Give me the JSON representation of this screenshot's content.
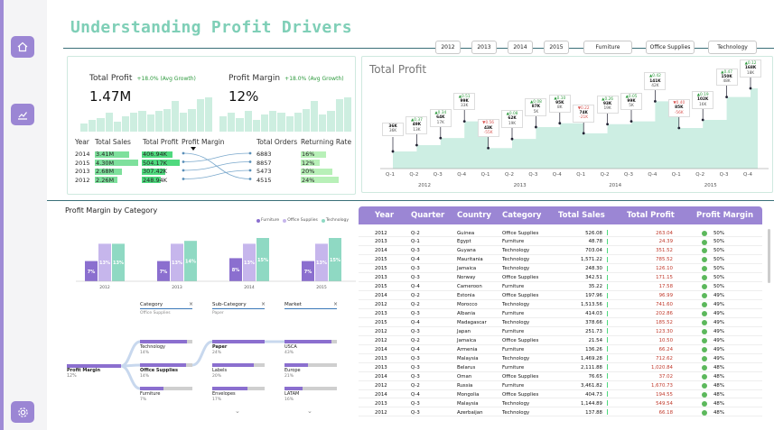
{
  "colors": {
    "accent": "#9b86d4",
    "mint": "#7fcfb7",
    "furniture": "#8b6fcf",
    "office": "#c6b6ec",
    "technology": "#8fd9c3",
    "up": "#2e9a3e",
    "down": "#d9534f"
  },
  "title": "Understanding Profit Drivers",
  "nav": {
    "icons": [
      "home-icon",
      "chart-icon",
      "settings-icon"
    ]
  },
  "slicers": {
    "years": [
      "2012",
      "2013",
      "2014",
      "2015"
    ],
    "categories": [
      "Furniture",
      "Office Supplies",
      "Technology"
    ]
  },
  "kpi": {
    "total_profit": {
      "label": "Total Profit",
      "growth": "+18.0% (Avg Growth)",
      "value": "1.47M"
    },
    "profit_margin": {
      "label": "Profit Margin",
      "growth": "+18.0% (Avg Growth)",
      "value": "12%"
    }
  },
  "year_table": {
    "headers": [
      "Year",
      "Total Sales",
      "Total Profit",
      "Profit Margin",
      "Total Orders",
      "Returning Rate"
    ],
    "rows": [
      {
        "year": "2014",
        "sales": "3.41M",
        "profit": "406.94K",
        "orders": "6883",
        "rate": "16%",
        "s": 0.79,
        "p": 0.81,
        "r": 0.67
      },
      {
        "year": "2015",
        "sales": "4.30M",
        "profit": "504.17K",
        "orders": "8857",
        "rate": "12%",
        "s": 1.0,
        "p": 1.0,
        "r": 0.5
      },
      {
        "year": "2013",
        "sales": "2.68M",
        "profit": "307.42K",
        "orders": "5473",
        "rate": "20%",
        "s": 0.62,
        "p": 0.61,
        "r": 0.83
      },
      {
        "year": "2012",
        "sales": "2.26M",
        "profit": "248.94K",
        "orders": "4515",
        "rate": "24%",
        "s": 0.53,
        "p": 0.49,
        "r": 1.0
      }
    ]
  },
  "total_profit_chart": {
    "title": "Total Profit",
    "years": [
      "2012",
      "2013",
      "2014",
      "2015"
    ],
    "quarters": [
      "Q-1",
      "Q-2",
      "Q-3",
      "Q-4"
    ],
    "points": [
      {
        "v": "36K",
        "s": "36K",
        "c": ""
      },
      {
        "v": "49K",
        "s": "13K",
        "c": "▲0.37"
      },
      {
        "v": "64K",
        "s": "17K",
        "c": "▲0.34"
      },
      {
        "v": "99K",
        "s": "33K",
        "c": "▲0.51"
      },
      {
        "v": "43K",
        "s": "-55K",
        "c": "▼0.56"
      },
      {
        "v": "62K",
        "s": "19K",
        "c": "▲0.08"
      },
      {
        "v": "87K",
        "s": "5K",
        "c": "▲0.08"
      },
      {
        "v": "95K",
        "s": "8K",
        "c": "▲0.10"
      },
      {
        "v": "74K",
        "s": "-21K",
        "c": "▼0.22"
      },
      {
        "v": "93K",
        "s": "19K",
        "c": "▲0.26"
      },
      {
        "v": "99K",
        "s": "5K",
        "c": "▲0.05"
      },
      {
        "v": "141K",
        "s": "42K",
        "c": "▲0.42"
      },
      {
        "v": "85K",
        "s": "-56K",
        "c": "▼0.40"
      },
      {
        "v": "102K",
        "s": "16K",
        "c": "▲0.19"
      },
      {
        "v": "150K",
        "s": "48K",
        "c": "▲0.47"
      },
      {
        "v": "168K",
        "s": "18K",
        "c": "▲0.12"
      }
    ]
  },
  "margin_by_category": {
    "title": "Profit Margin by Category",
    "legend": [
      "Furniture",
      "Office Supplies",
      "Technology"
    ],
    "years": [
      "2012",
      "2013",
      "2014",
      "2015"
    ],
    "values": [
      [
        7,
        13,
        13
      ],
      [
        7,
        13,
        14
      ],
      [
        8,
        13,
        15
      ],
      [
        7,
        13,
        15
      ]
    ]
  },
  "decomp_tree": {
    "root": {
      "label": "Profit Margin",
      "value": "12%"
    },
    "levels": [
      {
        "header": "Category",
        "sub": "Office Supplies",
        "items": [
          {
            "label": "Technology",
            "value": "14%"
          },
          {
            "label": "Office Supplies",
            "value": "14%"
          },
          {
            "label": "Furniture",
            "value": "7%"
          }
        ]
      },
      {
        "header": "Sub-Category",
        "sub": "Paper",
        "items": [
          {
            "label": "Paper",
            "value": "24%"
          },
          {
            "label": "Labels",
            "value": "20%"
          },
          {
            "label": "Envelopes",
            "value": "17%"
          }
        ]
      },
      {
        "header": "Market",
        "sub": "",
        "items": [
          {
            "label": "USCA",
            "value": "43%"
          },
          {
            "label": "Europe",
            "value": "21%"
          },
          {
            "label": "LATAM",
            "value": "16%"
          }
        ]
      }
    ]
  },
  "detail_table": {
    "headers": [
      "Year",
      "Quarter",
      "Country",
      "Category",
      "Total Sales",
      "Total Profit",
      "Profit Margin"
    ],
    "rows": [
      [
        "2012",
        "Q-2",
        "Guinea",
        "Office Supplies",
        "526.08",
        "263.04",
        "50%"
      ],
      [
        "2013",
        "Q-1",
        "Egypt",
        "Furniture",
        "48.78",
        "24.39",
        "50%"
      ],
      [
        "2014",
        "Q-3",
        "Guyana",
        "Technology",
        "703.04",
        "351.52",
        "50%"
      ],
      [
        "2015",
        "Q-4",
        "Mauritania",
        "Technology",
        "1,571.22",
        "785.52",
        "50%"
      ],
      [
        "2015",
        "Q-3",
        "Jamaica",
        "Technology",
        "248.30",
        "126.10",
        "50%"
      ],
      [
        "2013",
        "Q-3",
        "Norway",
        "Office Supplies",
        "342.51",
        "171.15",
        "50%"
      ],
      [
        "2015",
        "Q-4",
        "Cameroon",
        "Furniture",
        "35.22",
        "17.58",
        "50%"
      ],
      [
        "2014",
        "Q-2",
        "Estonia",
        "Office Supplies",
        "197.96",
        "96.99",
        "49%"
      ],
      [
        "2012",
        "Q-2",
        "Morocco",
        "Technology",
        "1,513.56",
        "741.60",
        "49%"
      ],
      [
        "2013",
        "Q-3",
        "Albania",
        "Furniture",
        "414.03",
        "202.86",
        "49%"
      ],
      [
        "2015",
        "Q-4",
        "Madagascar",
        "Technology",
        "378.66",
        "185.52",
        "49%"
      ],
      [
        "2012",
        "Q-3",
        "Japan",
        "Furniture",
        "251.73",
        "123.30",
        "49%"
      ],
      [
        "2012",
        "Q-2",
        "Jamaica",
        "Office Supplies",
        "21.54",
        "10.50",
        "49%"
      ],
      [
        "2014",
        "Q-4",
        "Armenia",
        "Furniture",
        "136.26",
        "66.24",
        "49%"
      ],
      [
        "2013",
        "Q-3",
        "Malaysia",
        "Technology",
        "1,469.28",
        "712.62",
        "49%"
      ],
      [
        "2013",
        "Q-3",
        "Belarus",
        "Furniture",
        "2,111.88",
        "1,020.84",
        "48%"
      ],
      [
        "2014",
        "Q-3",
        "Oman",
        "Office Supplies",
        "76.65",
        "37.02",
        "48%"
      ],
      [
        "2012",
        "Q-2",
        "Russia",
        "Furniture",
        "3,461.82",
        "1,670.73",
        "48%"
      ],
      [
        "2014",
        "Q-4",
        "Mongolia",
        "Office Supplies",
        "404.73",
        "194.55",
        "48%"
      ],
      [
        "2013",
        "Q-3",
        "Malaysia",
        "Technology",
        "1,144.89",
        "549.54",
        "48%"
      ],
      [
        "2012",
        "Q-3",
        "Azerbaijan",
        "Technology",
        "137.88",
        "66.18",
        "48%"
      ]
    ]
  }
}
